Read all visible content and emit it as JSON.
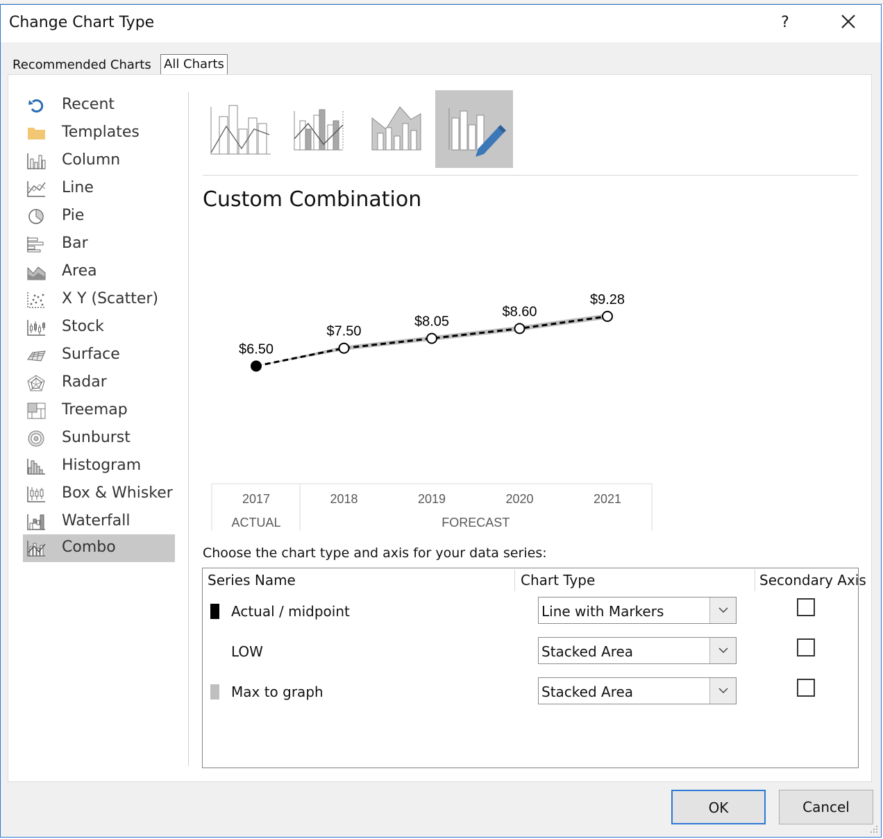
{
  "dialog": {
    "title": "Change Chart Type",
    "help": "?",
    "tabs": [
      {
        "label": "Recommended Charts",
        "active": false
      },
      {
        "label": "All Charts",
        "active": true
      }
    ]
  },
  "categories": [
    {
      "label": "Recent",
      "icon": "recent-icon"
    },
    {
      "label": "Templates",
      "icon": "templates-folder-icon"
    },
    {
      "label": "Column",
      "icon": "column-chart-icon"
    },
    {
      "label": "Line",
      "icon": "line-chart-icon"
    },
    {
      "label": "Pie",
      "icon": "pie-chart-icon"
    },
    {
      "label": "Bar",
      "icon": "bar-chart-icon"
    },
    {
      "label": "Area",
      "icon": "area-chart-icon"
    },
    {
      "label": "X Y (Scatter)",
      "icon": "scatter-chart-icon"
    },
    {
      "label": "Stock",
      "icon": "stock-chart-icon"
    },
    {
      "label": "Surface",
      "icon": "surface-chart-icon"
    },
    {
      "label": "Radar",
      "icon": "radar-chart-icon"
    },
    {
      "label": "Treemap",
      "icon": "treemap-chart-icon"
    },
    {
      "label": "Sunburst",
      "icon": "sunburst-chart-icon"
    },
    {
      "label": "Histogram",
      "icon": "histogram-chart-icon"
    },
    {
      "label": "Box & Whisker",
      "icon": "box-whisker-chart-icon"
    },
    {
      "label": "Waterfall",
      "icon": "waterfall-chart-icon"
    },
    {
      "label": "Combo",
      "icon": "combo-chart-icon",
      "selected": true
    }
  ],
  "combo_subtypes": [
    {
      "icon": "clustered-column-line-icon",
      "selected": false
    },
    {
      "icon": "clustered-column-line-secondary-axis-icon",
      "selected": false
    },
    {
      "icon": "stacked-area-clustered-column-icon",
      "selected": false
    },
    {
      "icon": "custom-combination-icon",
      "selected": true
    }
  ],
  "subtype_title": "Custom Combination",
  "chart_data": {
    "type": "line",
    "categories": [
      "2017",
      "2018",
      "2019",
      "2020",
      "2021"
    ],
    "category_groups": [
      {
        "label": "ACTUAL",
        "span": 1
      },
      {
        "label": "FORECAST",
        "span": 4
      }
    ],
    "series": [
      {
        "name": "Actual / midpoint",
        "values": [
          6.5,
          7.5,
          8.05,
          8.6,
          9.28
        ],
        "data_labels": [
          "$6.50",
          "$7.50",
          "$8.05",
          "$8.60",
          "$9.28"
        ],
        "color": "#000000"
      },
      {
        "name": "LOW",
        "values": [
          6.5,
          7.38,
          7.92,
          8.47,
          9.14
        ]
      },
      {
        "name": "Max to graph",
        "values": [
          0,
          0.24,
          0.26,
          0.27,
          0.28
        ],
        "color": "#bfbfbf"
      }
    ],
    "ylim": [
      0,
      13
    ],
    "grid": false
  },
  "instruction": "Choose the chart type and axis for your data series:",
  "series_table": {
    "headers": {
      "name": "Series Name",
      "type": "Chart Type",
      "axis": "Secondary Axis"
    },
    "rows": [
      {
        "name": "Actual / midpoint",
        "chart_type": "Line with Markers",
        "secondary_axis": false,
        "swatch": "#000000"
      },
      {
        "name": "LOW",
        "chart_type": "Stacked Area",
        "secondary_axis": false,
        "swatch": ""
      },
      {
        "name": "Max to graph",
        "chart_type": "Stacked Area",
        "secondary_axis": false,
        "swatch": "#bfbfbf"
      }
    ]
  },
  "buttons": {
    "ok": "OK",
    "cancel": "Cancel"
  }
}
